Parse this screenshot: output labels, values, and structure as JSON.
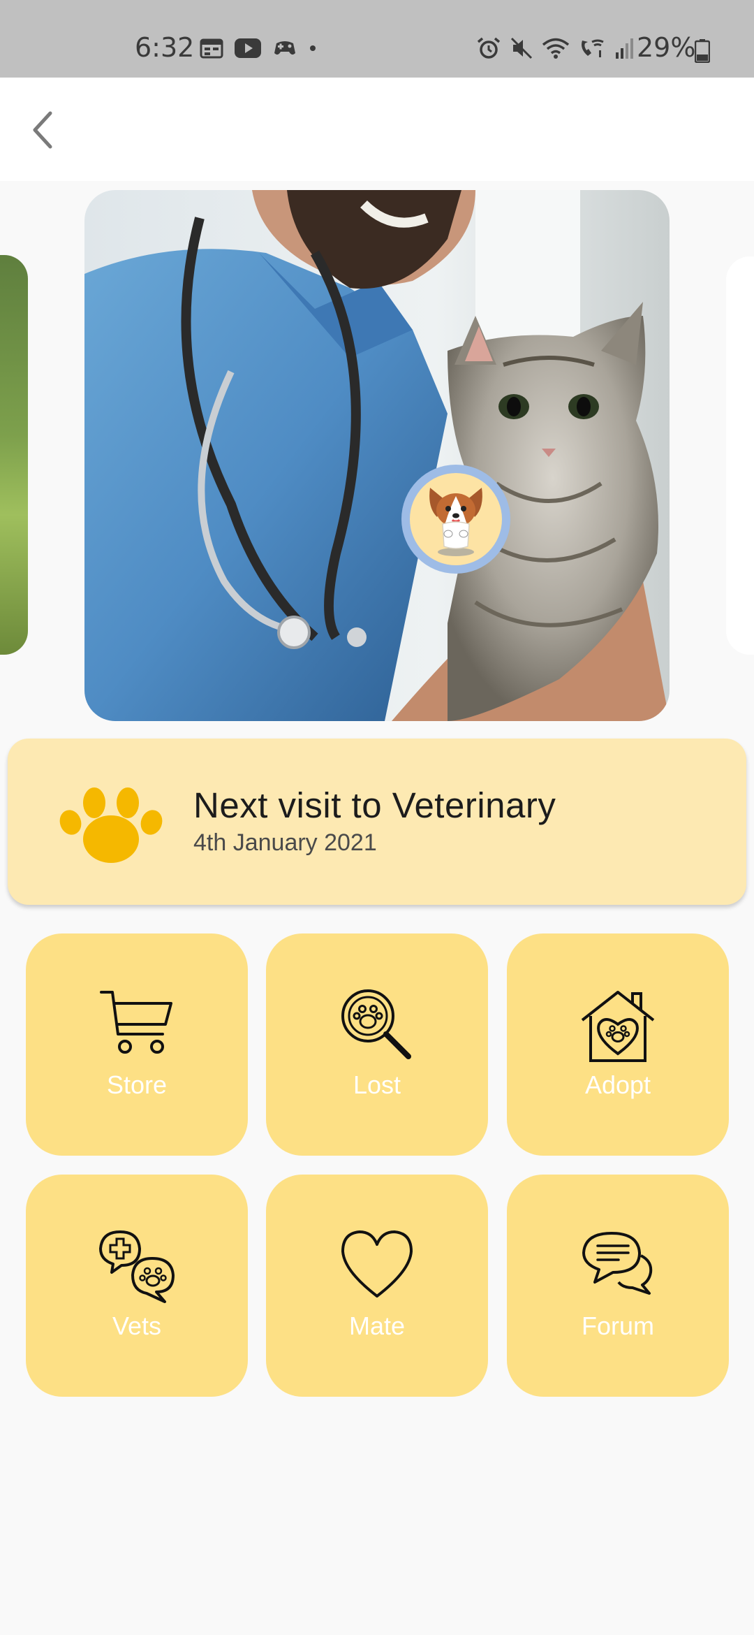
{
  "status_bar": {
    "time": "6:32",
    "battery_percent": "29%",
    "left_icons": [
      "calendar-icon",
      "youtube-icon",
      "game-icon",
      "dot-icon"
    ],
    "right_icons": [
      "alarm-icon",
      "mute-icon",
      "wifi-icon",
      "wifi-call-icon",
      "signal-icon",
      "battery-icon"
    ]
  },
  "app_bar": {
    "back_icon": "chevron-left-icon"
  },
  "carousel": {
    "current_slide": "vet-with-cat-photo",
    "badge_icon": "puppy-avatar-icon"
  },
  "visit_card": {
    "icon": "paw-icon",
    "title": "Next visit to Veterinary",
    "date": "4th January 2021",
    "accent_color": "#f5b800"
  },
  "menu": {
    "tiles": [
      {
        "label": "Store",
        "icon": "shopping-cart-icon"
      },
      {
        "label": "Lost",
        "icon": "paw-magnifier-icon"
      },
      {
        "label": "Adopt",
        "icon": "heart-house-icon"
      },
      {
        "label": "Vets",
        "icon": "vet-chat-icon"
      },
      {
        "label": "Mate",
        "icon": "heart-icon"
      },
      {
        "label": "Forum",
        "icon": "chat-bubble-icon"
      }
    ],
    "tile_color": "#fde085"
  }
}
